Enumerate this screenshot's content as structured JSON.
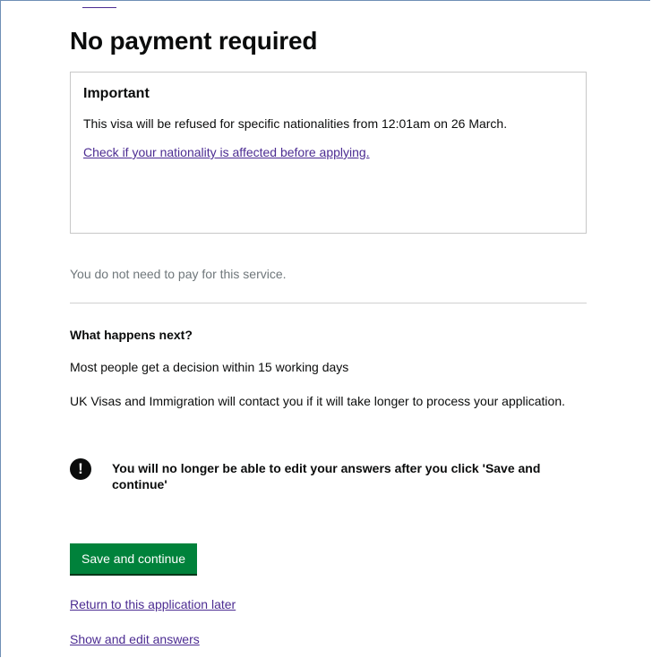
{
  "page": {
    "title": "No payment required"
  },
  "notice": {
    "heading": "Important",
    "text": "This visa will be refused for specific nationalities from 12:01am on 26 March.",
    "link": "Check if your nationality is affected before applying."
  },
  "payment": {
    "text": "You do not need to pay for this service."
  },
  "next_steps": {
    "heading": "What happens next?",
    "decision": "Most people get a decision within 15 working days",
    "contact": "UK Visas and Immigration will contact you if it will take longer to process your application."
  },
  "warning": {
    "icon": "exclamation-icon",
    "icon_glyph": "!",
    "text": "You will no longer be able to edit your answers after you click 'Save and continue'"
  },
  "actions": {
    "save_label": "Save and continue",
    "return_link": "Return to this application later",
    "show_link": "Show and edit answers"
  },
  "colors": {
    "button": "#00823b",
    "link": "#4c2c92",
    "text": "#0b0c0c",
    "muted_text": "#6f777b"
  }
}
